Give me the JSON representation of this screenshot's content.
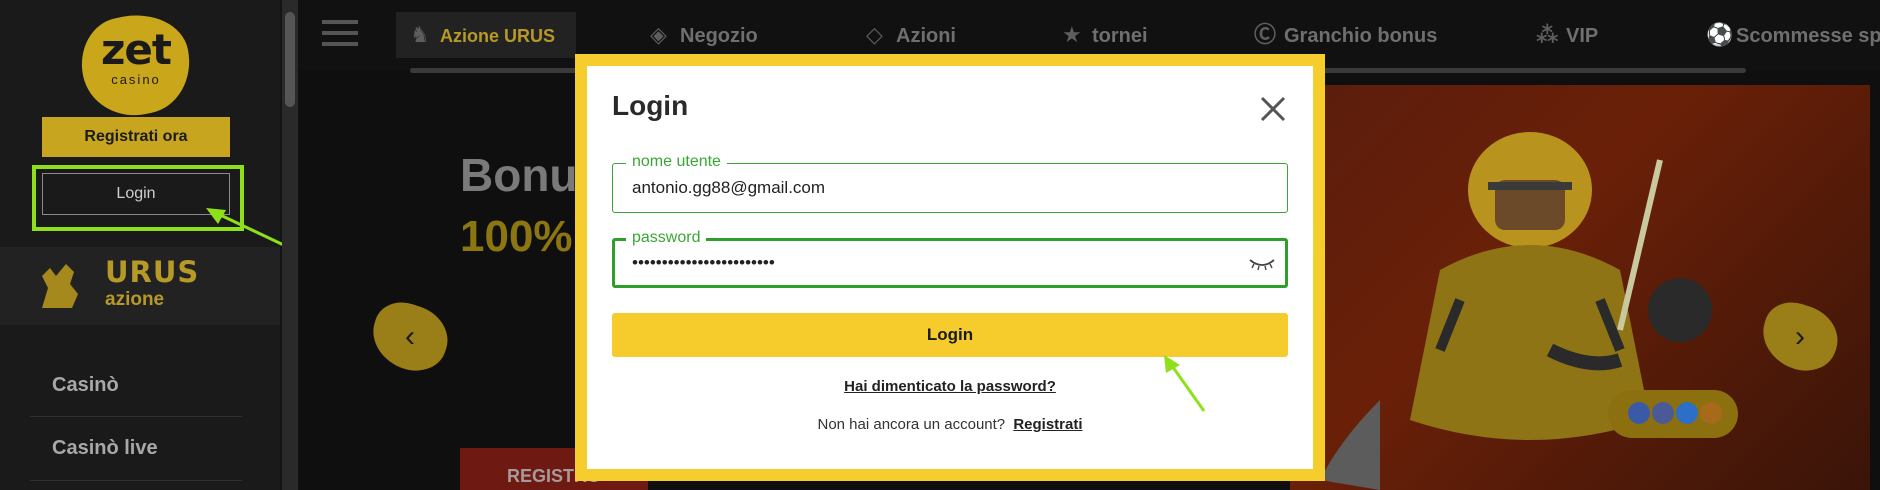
{
  "sidebar": {
    "logo_text": "zet",
    "logo_sub": "casino",
    "register_label": "Registrati ora",
    "login_label": "Login",
    "promo_title": "URUS",
    "promo_sub": "azione",
    "nav_items": [
      "Casinò",
      "Casinò live"
    ]
  },
  "topnav": {
    "items": [
      {
        "label": "Azione URUS",
        "icon": "bull-icon",
        "active": true
      },
      {
        "label": "Negozio",
        "icon": "tag-icon"
      },
      {
        "label": "Azioni",
        "icon": "diamond-icon"
      },
      {
        "label": "tornei",
        "icon": "trophy-icon"
      },
      {
        "label": "Granchio bonus",
        "icon": "bonus-crab-icon"
      },
      {
        "label": "VIP",
        "icon": "stars-icon"
      },
      {
        "label": "Scommesse sp",
        "icon": "soccer-ball-icon"
      }
    ]
  },
  "banner": {
    "title": "Bonus",
    "percent": "100%",
    "cta": "REGISTRO"
  },
  "modal": {
    "title": "Login",
    "username_label": "nome utente",
    "username_value": "antonio.gg88@gmail.com",
    "password_label": "password",
    "password_value": "••••••••••••••••••••••••",
    "submit_label": "Login",
    "forgot_label": "Hai dimenticato la password?",
    "no_account_text": "Non hai ancora un account?",
    "register_link": "Registrati"
  },
  "colors": {
    "brand_yellow": "#f6cc2d",
    "highlight_green": "#8ee01a",
    "field_green": "#3aa635"
  }
}
